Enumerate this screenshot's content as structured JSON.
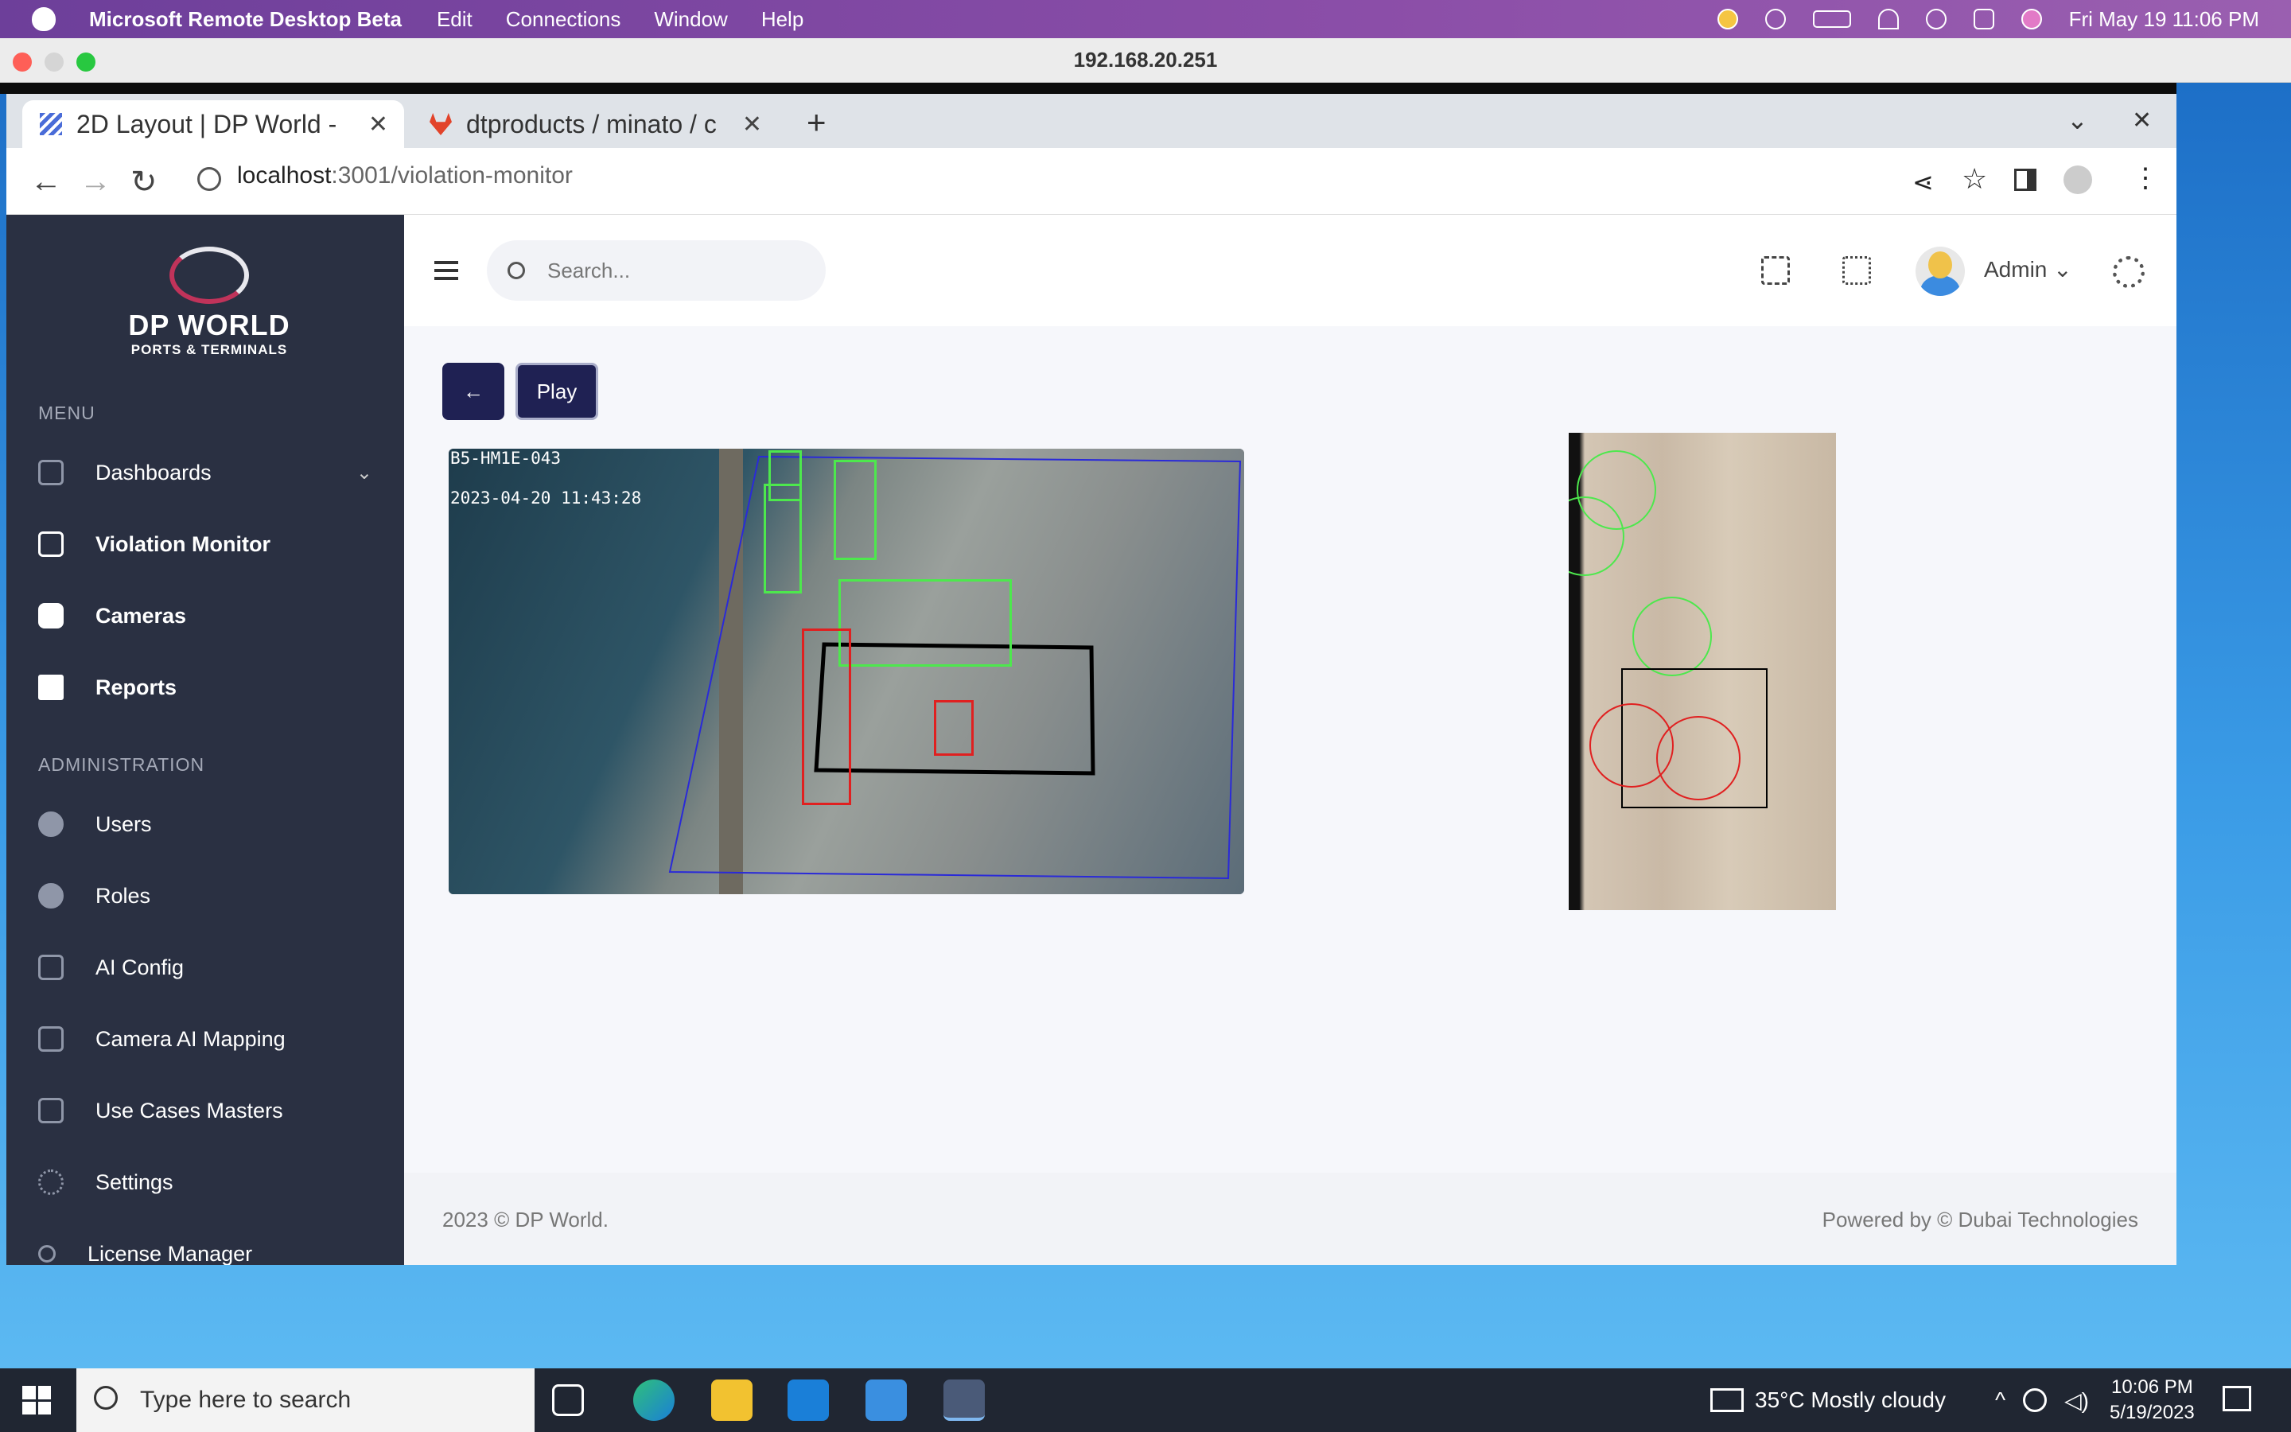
{
  "mac_menubar": {
    "app_name": "Microsoft Remote Desktop Beta",
    "menus": [
      "Edit",
      "Connections",
      "Window",
      "Help"
    ],
    "datetime": "Fri May 19  11:06 PM"
  },
  "rdp_window": {
    "title": "192.168.20.251"
  },
  "browser": {
    "tabs": [
      {
        "label": "2D Layout | DP World -",
        "active": true,
        "icon": "waves-favicon"
      },
      {
        "label": "dtproducts / minato / c",
        "active": false,
        "icon": "gitlab-icon"
      }
    ],
    "url_host": "localhost",
    "url_path": ":3001/violation-monitor"
  },
  "sidebar": {
    "brand_line1": "DP WORLD",
    "brand_line2": "PORTS & TERMINALS",
    "menu_label": "MENU",
    "admin_label": "ADMINISTRATION",
    "menu_items": [
      {
        "label": "Dashboards",
        "icon": "home-icon",
        "has_chevron": true
      },
      {
        "label": "Violation Monitor",
        "icon": "layout-icon",
        "active": true
      },
      {
        "label": "Cameras",
        "icon": "camera-icon"
      },
      {
        "label": "Reports",
        "icon": "report-icon"
      }
    ],
    "admin_items": [
      {
        "label": "Users",
        "icon": "user-icon"
      },
      {
        "label": "Roles",
        "icon": "user-icon"
      },
      {
        "label": "AI Config",
        "icon": "layout-icon"
      },
      {
        "label": "Camera AI Mapping",
        "icon": "layout-icon"
      },
      {
        "label": "Use Cases Masters",
        "icon": "layout-icon"
      },
      {
        "label": "Settings",
        "icon": "gear-icon"
      },
      {
        "label": "License Manager",
        "icon": "key-icon"
      }
    ]
  },
  "topbar": {
    "search_placeholder": "Search...",
    "user_name": "Admin"
  },
  "main": {
    "back_label": "←",
    "play_label": "Play",
    "camera_id": "B5-HM1E-043",
    "camera_timestamp": "2023-04-20 11:43:28"
  },
  "footer": {
    "left": "2023 © DP World.",
    "right": "Powered by © Dubai Technologies"
  },
  "taskbar": {
    "search_placeholder": "Type here to search",
    "weather": "35°C  Mostly cloudy",
    "time": "10:06 PM",
    "date": "5/19/2023"
  },
  "colors": {
    "sidebar_bg": "#2a3042",
    "button_bg": "#1f2153",
    "detect_green": "#4de84d",
    "detect_red": "#e02020",
    "zone_black": "#000000",
    "roi_blue": "#2a2ad8"
  }
}
